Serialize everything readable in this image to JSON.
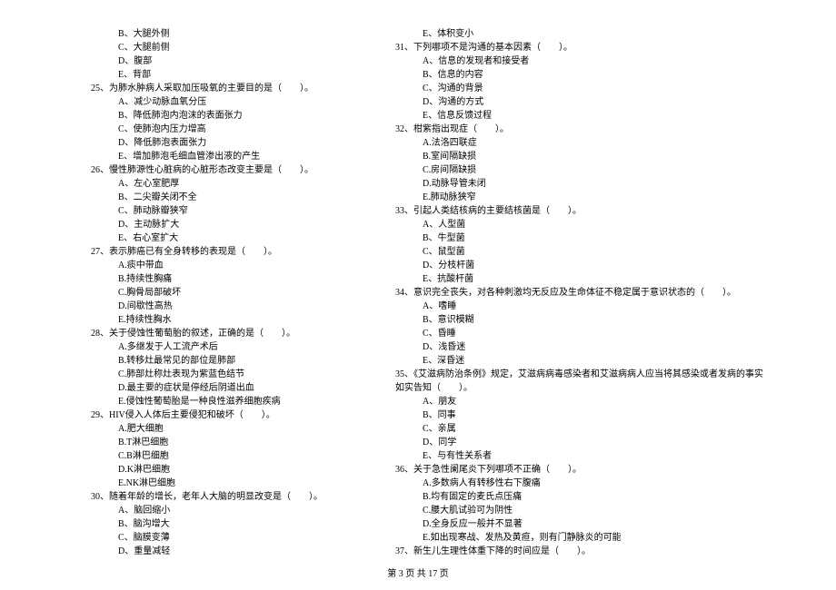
{
  "left_column": [
    {
      "type": "option",
      "text": "B、大腿外侧"
    },
    {
      "type": "option",
      "text": "C、大腿前侧"
    },
    {
      "type": "option",
      "text": "D、腹部"
    },
    {
      "type": "option",
      "text": "E、背部"
    },
    {
      "type": "stem",
      "text": "25、为肺水肿病人采取加压吸氧的主要目的是（　　）。"
    },
    {
      "type": "option",
      "text": "A、减少动脉血氧分压"
    },
    {
      "type": "option",
      "text": "B、降低肺泡内泡沫的表面张力"
    },
    {
      "type": "option",
      "text": "C、使肺泡内压力增高"
    },
    {
      "type": "option",
      "text": "D、降低肺泡表面张力"
    },
    {
      "type": "option",
      "text": "E、增加肺泡毛细血管渗出液的产生"
    },
    {
      "type": "stem",
      "text": "26、慢性肺源性心脏病的心脏形态改变主要是（　　）。"
    },
    {
      "type": "option",
      "text": "A、左心室肥厚"
    },
    {
      "type": "option",
      "text": "B、二尖瓣关闭不全"
    },
    {
      "type": "option",
      "text": "C、肺动脉瓣狭窄"
    },
    {
      "type": "option",
      "text": "D、主动脉扩大"
    },
    {
      "type": "option",
      "text": "E、右心室扩大"
    },
    {
      "type": "stem",
      "text": "27、表示肺癌已有全身转移的表现是（　　）。"
    },
    {
      "type": "option",
      "text": "A.痰中带血"
    },
    {
      "type": "option",
      "text": "B.持续性胸痛"
    },
    {
      "type": "option",
      "text": "C.胸骨局部破坏"
    },
    {
      "type": "option",
      "text": "D.间歇性高热"
    },
    {
      "type": "option",
      "text": "E.持续性胸水"
    },
    {
      "type": "stem",
      "text": "28、关于侵蚀性葡萄胎的叙述，正确的是（　　）。"
    },
    {
      "type": "option",
      "text": "A.多继发于人工流产术后"
    },
    {
      "type": "option",
      "text": "B.转移灶最常见的部位是肺部"
    },
    {
      "type": "option",
      "text": "C.肺部灶称灶表现为紫蓝色结节"
    },
    {
      "type": "option",
      "text": "D.最主要的症状是停经后阴道出血"
    },
    {
      "type": "option",
      "text": "E.侵蚀性葡萄胎是一种良性滋养细胞疾病"
    },
    {
      "type": "stem",
      "text": "29、HIV侵入人体后主要侵犯和破坏（　　）。"
    },
    {
      "type": "option",
      "text": "A.肥大细胞"
    },
    {
      "type": "option",
      "text": "B.T淋巴细胞"
    },
    {
      "type": "option",
      "text": "C.B淋巴细胞"
    },
    {
      "type": "option",
      "text": "D.K淋巴细胞"
    },
    {
      "type": "option",
      "text": "E.NK淋巴细胞"
    },
    {
      "type": "stem",
      "text": "30、随着年龄的增长，老年人大脑的明显改变是（　　）。"
    },
    {
      "type": "option",
      "text": "A、脑回缩小"
    },
    {
      "type": "option",
      "text": "B、脑沟增大"
    },
    {
      "type": "option",
      "text": "C、脑膜变薄"
    },
    {
      "type": "option",
      "text": "D、重量减轻"
    }
  ],
  "right_column": [
    {
      "type": "option",
      "text": "E、体积变小"
    },
    {
      "type": "stem",
      "text": "31、下列哪项不是沟通的基本因素（　　）。"
    },
    {
      "type": "option",
      "text": "A、信息的发现者和接受者"
    },
    {
      "type": "option",
      "text": "B、信息的内容"
    },
    {
      "type": "option",
      "text": "C、沟通的背景"
    },
    {
      "type": "option",
      "text": "D、沟通的方式"
    },
    {
      "type": "option",
      "text": "E、信息反馈过程"
    },
    {
      "type": "stem",
      "text": "32、柑紫指出现症（　　）。"
    },
    {
      "type": "option",
      "text": "A.法洛四联症"
    },
    {
      "type": "option",
      "text": "B.室间隔缺损"
    },
    {
      "type": "option",
      "text": "C.房间隔缺损"
    },
    {
      "type": "option",
      "text": "D.动脉导管未闭"
    },
    {
      "type": "option",
      "text": "E.肺动脉狭窄"
    },
    {
      "type": "stem",
      "text": "33、引起人类结核病的主要结核菌是（　　）。"
    },
    {
      "type": "option",
      "text": "A、人型菌"
    },
    {
      "type": "option",
      "text": "B、牛型菌"
    },
    {
      "type": "option",
      "text": "C、鼠型菌"
    },
    {
      "type": "option",
      "text": "D、分枝杆菌"
    },
    {
      "type": "option",
      "text": "E、抗酸杆菌"
    },
    {
      "type": "stem",
      "text": "34、意识完全丧失，对各种刺激均无反应及生命体征不稳定属于意识状态的（　　）。"
    },
    {
      "type": "option",
      "text": "A、嗜睡"
    },
    {
      "type": "option",
      "text": "B、意识模糊"
    },
    {
      "type": "option",
      "text": "C、昏睡"
    },
    {
      "type": "option",
      "text": "D、浅昏迷"
    },
    {
      "type": "option",
      "text": "E、深昏迷"
    },
    {
      "type": "stem",
      "text": "35、《艾滋病防治条例》规定，艾滋病病毒感染者和艾滋病病人应当将其感染或者发病的事实"
    },
    {
      "type": "cont",
      "text": "如实告知（　　）。"
    },
    {
      "type": "option",
      "text": "A、朋友"
    },
    {
      "type": "option",
      "text": "B、同事"
    },
    {
      "type": "option",
      "text": "C、亲属"
    },
    {
      "type": "option",
      "text": "D、同学"
    },
    {
      "type": "option",
      "text": "E、与有性关系者"
    },
    {
      "type": "stem",
      "text": "36、关于急性阑尾炎下列哪项不正确（　　）。"
    },
    {
      "type": "option",
      "text": "A.多数病人有转移性右下腹痛"
    },
    {
      "type": "option",
      "text": "B.均有固定的麦氏点压痛"
    },
    {
      "type": "option",
      "text": "C.腰大肌试验可为阴性"
    },
    {
      "type": "option",
      "text": "D.全身反应一般并不显著"
    },
    {
      "type": "option",
      "text": "E.如出现寒战、发热及黄疸，则有门静脉炎的可能"
    },
    {
      "type": "stem",
      "text": "37、新生儿生理性体重下降的时间应是（　　）。"
    }
  ],
  "footer": "第 3 页 共 17 页"
}
